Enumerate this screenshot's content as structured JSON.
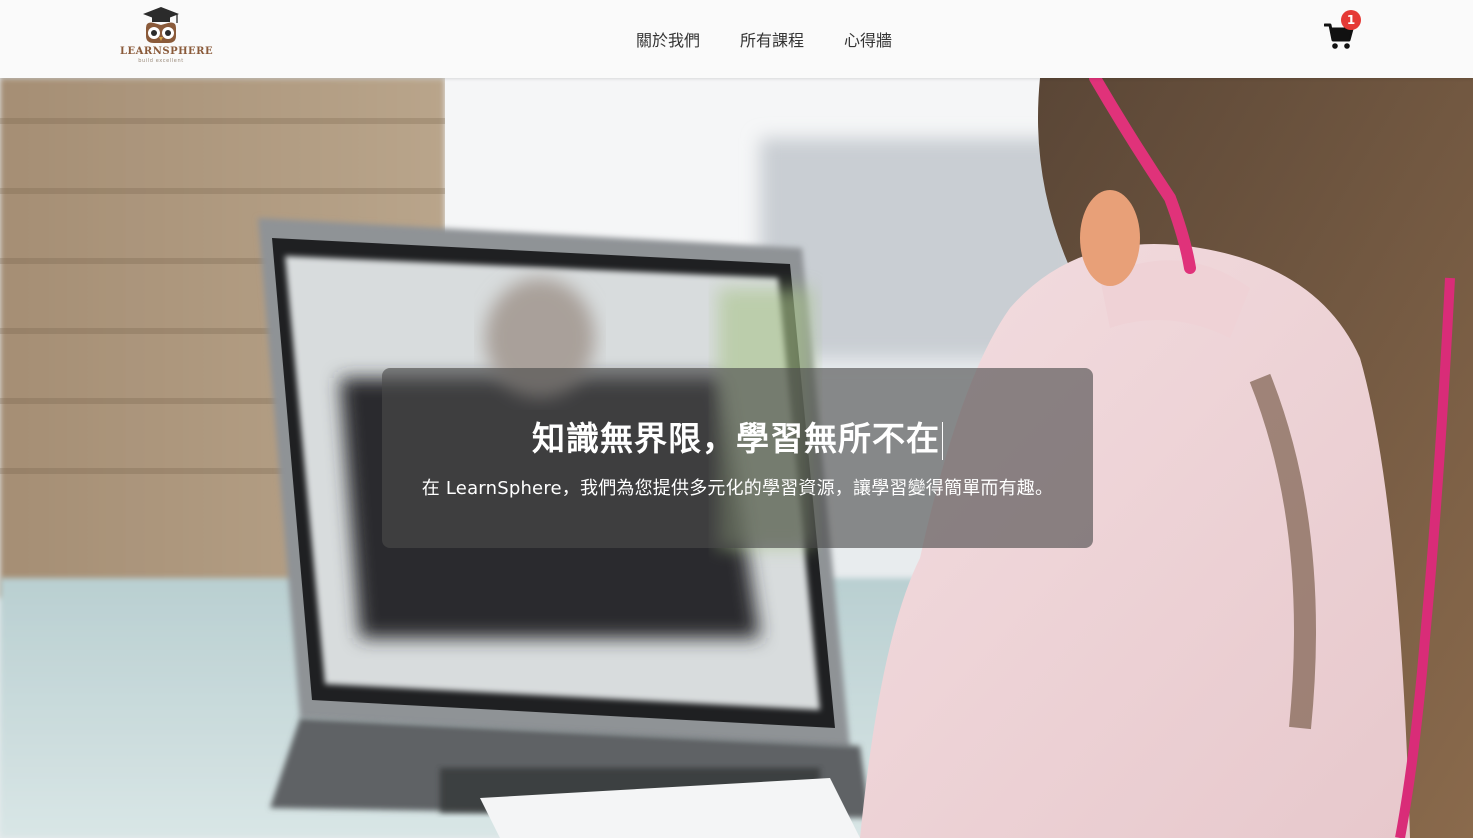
{
  "brand": {
    "name": "LEARNSPHERE",
    "tagline": "build excellent",
    "accent_color": "#8a5a3a"
  },
  "nav": {
    "items": [
      {
        "label": "關於我們"
      },
      {
        "label": "所有課程"
      },
      {
        "label": "心得牆"
      }
    ]
  },
  "cart": {
    "icon": "shopping-cart-icon",
    "count": "1",
    "badge_color": "#e53935"
  },
  "hero": {
    "title": "知識無界限，學習無所不在",
    "subtitle": "在 LearnSphere，我們為您提供多元化的學習資源，讓學習變得簡單而有趣。",
    "background": "photo of a girl in a pink hoodie watching a teacher on a laptop"
  }
}
